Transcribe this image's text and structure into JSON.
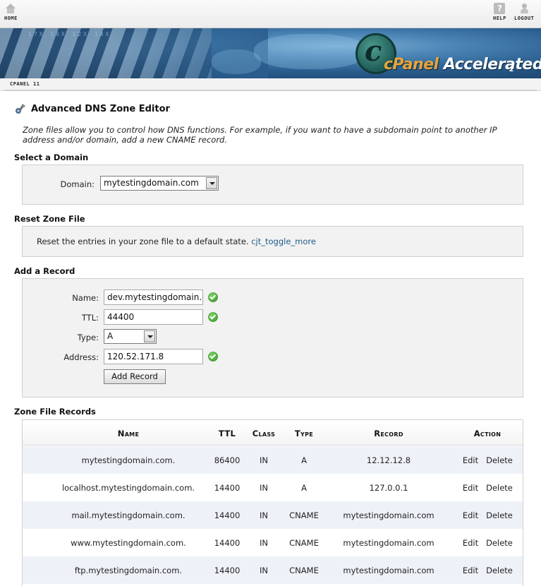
{
  "nav": {
    "home_label": "HOME",
    "help_label": "HELP",
    "logout_label": "LOGOUT"
  },
  "banner": {
    "logo_c": "c",
    "logo_brand": "cPanel",
    "logo_product": " Accelerated",
    "logo_version": "2",
    "digits": "17X  10X  12X  14X"
  },
  "breadcrumb": {
    "label": "CPANEL 11"
  },
  "page": {
    "title": "Advanced DNS Zone Editor",
    "intro": "Zone files allow you to control how DNS functions. For example, if you want to have a subdomain point to another IP address and/or domain, add a new CNAME record."
  },
  "select_domain": {
    "heading": "Select a Domain",
    "label": "Domain:",
    "value": "mytestingdomain.com"
  },
  "reset_zone": {
    "heading": "Reset Zone File",
    "text": "Reset the entries in your zone file to a default state.",
    "link": "cjt_toggle_more"
  },
  "add_record": {
    "heading": "Add a Record",
    "name_label": "Name:",
    "name_value": "dev.mytestingdomain.c",
    "ttl_label": "TTL:",
    "ttl_value": "44400",
    "type_label": "Type:",
    "type_value": "A",
    "address_label": "Address:",
    "address_value": "120.52.171.8",
    "button_label": "Add Record"
  },
  "zone_records": {
    "heading": "Zone File Records",
    "columns": {
      "name": "Name",
      "ttl": "TTL",
      "class": "Class",
      "type": "Type",
      "record": "Record",
      "action": "Action"
    },
    "edit_label": "Edit",
    "delete_label": "Delete",
    "rows": [
      {
        "name": "mytestingdomain.com.",
        "ttl": "86400",
        "class": "IN",
        "type": "A",
        "record": "12.12.12.8"
      },
      {
        "name": "localhost.mytestingdomain.com.",
        "ttl": "14400",
        "class": "IN",
        "type": "A",
        "record": "127.0.0.1"
      },
      {
        "name": "mail.mytestingdomain.com.",
        "ttl": "14400",
        "class": "IN",
        "type": "CNAME",
        "record": "mytestingdomain.com"
      },
      {
        "name": "www.mytestingdomain.com.",
        "ttl": "14400",
        "class": "IN",
        "type": "CNAME",
        "record": "mytestingdomain.com"
      },
      {
        "name": "ftp.mytestingdomain.com.",
        "ttl": "14400",
        "class": "IN",
        "type": "CNAME",
        "record": "mytestingdomain.com"
      }
    ]
  },
  "colors": {
    "link": "#1e5b8a",
    "row_alt": "#eef2f8",
    "panel_bg": "#f2f2f2",
    "check_green": "#2f8f21",
    "logo_orange": "#e8a53a"
  }
}
